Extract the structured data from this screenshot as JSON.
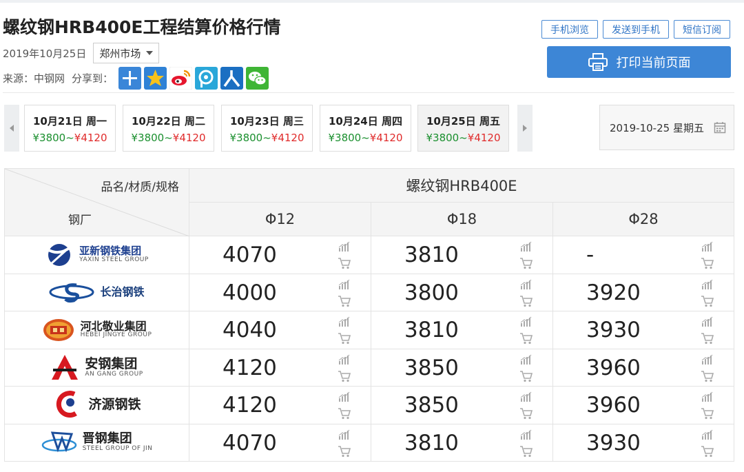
{
  "title": "螺纹钢HRB400E工程结算价格行情",
  "date": "2019年10月25日",
  "market": "郑州市场",
  "source_label": "来源：中钢网",
  "share_label": "分享到：",
  "share_icons": [
    "plus-icon",
    "star-icon",
    "weibo-icon",
    "tencent-icon",
    "renren-icon",
    "wechat-icon"
  ],
  "top_buttons": [
    "手机浏览",
    "发送到手机",
    "短信订阅"
  ],
  "print_button": "打印当前页面",
  "days": [
    {
      "date": "10月21日 周一",
      "low": "¥3800~",
      "high": "¥4120"
    },
    {
      "date": "10月22日 周二",
      "low": "¥3800~",
      "high": "¥4120"
    },
    {
      "date": "10月23日 周三",
      "low": "¥3800~",
      "high": "¥4120"
    },
    {
      "date": "10月24日 周四",
      "low": "¥3800~",
      "high": "¥4120"
    },
    {
      "date": "10月25日 周五",
      "low": "¥3800~",
      "high": "¥4120"
    }
  ],
  "date_picker": "2019-10-25 星期五",
  "table": {
    "corner_top": "品名/材质/规格",
    "corner_bottom": "钢厂",
    "product": "螺纹钢HRB400E",
    "specs": [
      "Φ12",
      "Φ18",
      "Φ28"
    ],
    "rows": [
      {
        "mill_cn": "亚新钢铁集团",
        "mill_en": "YAXIN STEEL GROUP",
        "values": [
          "4070",
          "3810",
          "-"
        ]
      },
      {
        "mill_cn": "长治钢铁",
        "mill_en": "",
        "values": [
          "4000",
          "3800",
          "3920"
        ]
      },
      {
        "mill_cn": "河北敬业集团",
        "mill_en": "HEBEI JINGYE GROUP",
        "values": [
          "4040",
          "3810",
          "3930"
        ]
      },
      {
        "mill_cn": "安钢集团",
        "mill_en": "AN GANG GROUP",
        "values": [
          "4120",
          "3850",
          "3960"
        ]
      },
      {
        "mill_cn": "济源钢铁",
        "mill_en": "",
        "values": [
          "4120",
          "3850",
          "3960"
        ]
      },
      {
        "mill_cn": "晋钢集团",
        "mill_en": "STEEL GROUP OF JIN",
        "values": [
          "4070",
          "3810",
          "3930"
        ]
      }
    ]
  },
  "colors": {
    "accent": "#3d86d6",
    "low_price": "#1a8f2e",
    "high_price": "#e02b2b"
  }
}
